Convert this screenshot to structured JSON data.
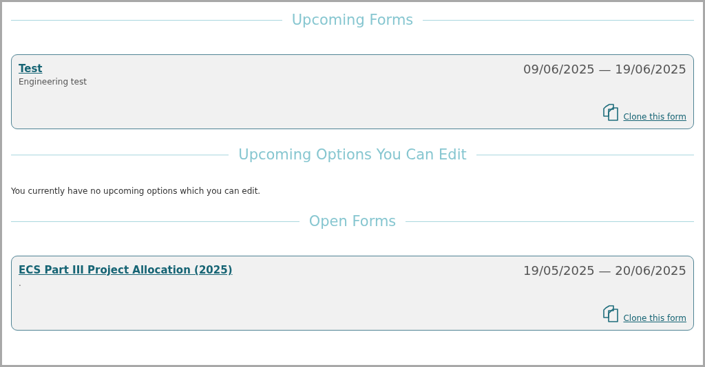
{
  "sections": [
    {
      "heading": "Upcoming Forms",
      "kind": "forms",
      "forms": [
        {
          "title": "Test",
          "description": "Engineering test",
          "dates": "09/06/2025 — 19/06/2025",
          "clone_link": "Clone this form"
        }
      ]
    },
    {
      "heading": "Upcoming Options You Can Edit",
      "kind": "message",
      "message": "You currently have no upcoming options which you can edit."
    },
    {
      "heading": "Open Forms",
      "kind": "forms",
      "forms": [
        {
          "title": "ECS Part III Project Allocation (2025)",
          "description": ".",
          "dates": "19/05/2025 — 20/06/2025",
          "clone_link": "Clone this form"
        }
      ]
    }
  ]
}
